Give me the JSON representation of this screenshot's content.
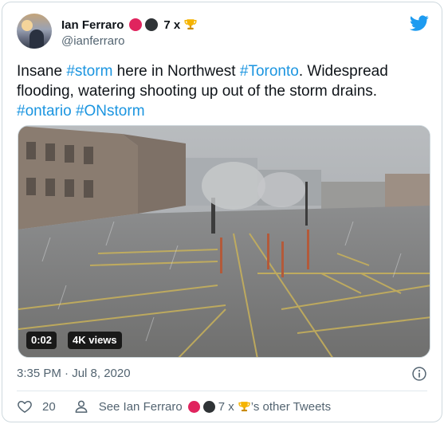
{
  "author": {
    "display_name": "Ian Ferraro",
    "badge_text": "7 x",
    "handle": "@ianferraro",
    "emoji_badges": [
      "red-circle-icon",
      "black-circle-icon",
      "trophy-icon"
    ]
  },
  "tweet": {
    "text_plain_1": "Insane ",
    "tag_storm": "#storm",
    "text_plain_2": " here in Northwest ",
    "tag_toronto": "#Toronto",
    "text_plain_3": ". Widespread flooding, watering shooting up out of the storm drains.",
    "tag_ontario": "#ontario",
    "tag_onstorm": "#ONstorm"
  },
  "video": {
    "duration": "0:02",
    "views": "4K views"
  },
  "timestamp": "3:35 PM · Jul 8, 2020",
  "actions": {
    "like_count": "20",
    "see_prefix": "See Ian Ferraro",
    "see_badge_text": "7 x",
    "see_suffix": "’s other Tweets"
  },
  "colors": {
    "link": "#1b95e0",
    "twitter_blue": "#1d9bf0",
    "muted": "#536471",
    "red_circle": "#e0245e"
  }
}
